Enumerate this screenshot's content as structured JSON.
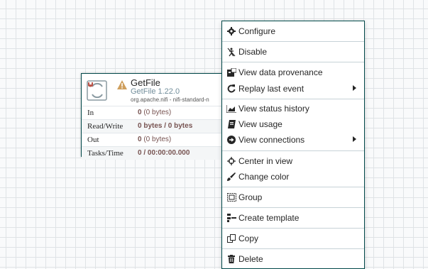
{
  "processor": {
    "name": "GetFile",
    "type": "GetFile 1.22.0",
    "bundle": "org.apache.nifi - nifi-standard-n",
    "stats": [
      {
        "label": "In",
        "value": "0",
        "unit": "(0 bytes)"
      },
      {
        "label": "Read/Write",
        "value": "0 bytes / 0 bytes",
        "unit": ""
      },
      {
        "label": "Out",
        "value": "0",
        "unit": "(0 bytes)"
      },
      {
        "label": "Tasks/Time",
        "value": "0 / 00:00:00.000",
        "unit": ""
      }
    ]
  },
  "menu": {
    "items": [
      {
        "label": "Configure",
        "icon": "gear-icon"
      },
      {
        "label": "Disable",
        "icon": "disable-icon"
      },
      {
        "label": "View data provenance",
        "icon": "provenance-icon"
      },
      {
        "label": "Replay last event",
        "icon": "replay-icon"
      },
      {
        "label": "View status history",
        "icon": "chart-area-icon"
      },
      {
        "label": "View usage",
        "icon": "book-icon"
      },
      {
        "label": "View connections",
        "icon": "connections-icon"
      },
      {
        "label": "Center in view",
        "icon": "crosshairs-icon"
      },
      {
        "label": "Change color",
        "icon": "paintbrush-icon"
      },
      {
        "label": "Group",
        "icon": "group-icon"
      },
      {
        "label": "Create template",
        "icon": "template-icon"
      },
      {
        "label": "Copy",
        "icon": "copy-icon"
      },
      {
        "label": "Delete",
        "icon": "trash-icon"
      }
    ]
  },
  "colors": {
    "border": "#004849",
    "accent": "#728e9b",
    "value": "#775351",
    "warning": "#cf9f5d"
  }
}
